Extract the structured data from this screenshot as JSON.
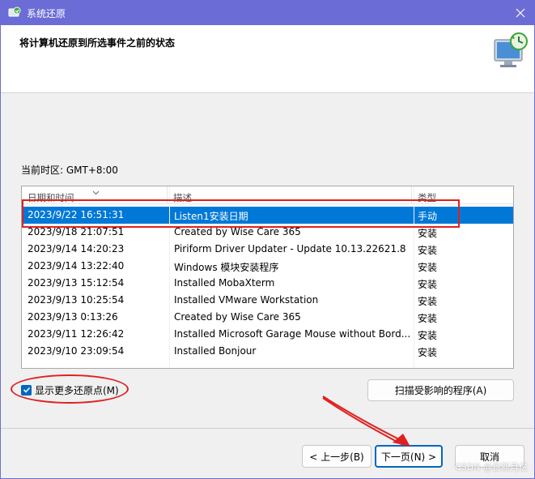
{
  "window": {
    "title": "系统还原",
    "close_glyph": "✕"
  },
  "header": {
    "heading": "将计算机还原到所选事件之前的状态"
  },
  "timezone": "当前时区: GMT+8:00",
  "table": {
    "columns": [
      "日期和时间",
      "描述",
      "类型"
    ],
    "rows": [
      {
        "date": "2023/9/22 16:51:31",
        "desc": "Listen1安装日期",
        "type": "手动",
        "selected": true
      },
      {
        "date": "2023/9/18 21:07:51",
        "desc": "Created by Wise Care 365",
        "type": "安装"
      },
      {
        "date": "2023/9/14 14:20:23",
        "desc": "Piriform Driver Updater - Update 10.13.22621.8",
        "type": "安装"
      },
      {
        "date": "2023/9/14 13:22:40",
        "desc": "Windows 模块安装程序",
        "type": "安装"
      },
      {
        "date": "2023/9/13 15:12:54",
        "desc": "Installed MobaXterm",
        "type": "安装"
      },
      {
        "date": "2023/9/13 10:25:54",
        "desc": "Installed VMware Workstation",
        "type": "安装"
      },
      {
        "date": "2023/9/13 0:13:26",
        "desc": "Created by Wise Care 365",
        "type": "安装"
      },
      {
        "date": "2023/9/11 12:26:42",
        "desc": "Installed Microsoft Garage Mouse without Bord...",
        "type": "安装"
      },
      {
        "date": "2023/9/10 23:09:54",
        "desc": "Installed Bonjour",
        "type": "安装"
      }
    ]
  },
  "checkbox": {
    "label": "显示更多还原点(M)",
    "checked": true
  },
  "buttons": {
    "scan": "扫描受影响的程序(A)",
    "back": "< 上一步(B)",
    "next": "下一页(N) >",
    "cancel": "取消"
  },
  "watermark": "CSDN @日新月亿",
  "colors": {
    "titlebar": "#6c6cd6",
    "selection": "#0078d7",
    "annotation": "#e02020"
  }
}
